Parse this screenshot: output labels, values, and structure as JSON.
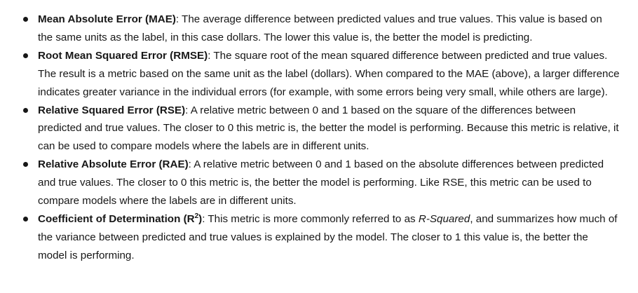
{
  "metrics": [
    {
      "term": "Mean Absolute Error (MAE)",
      "description": ": The average difference between predicted values and true values. This value is based on the same units as the label, in this case dollars. The lower this value is, the better the model is predicting."
    },
    {
      "term": "Root Mean Squared Error (RMSE)",
      "description": ": The square root of the mean squared difference between predicted and true values. The result is a metric based on the same unit as the label (dollars). When compared to the MAE (above), a larger difference indicates greater variance in the individual errors (for example, with some errors being very small, while others are large)."
    },
    {
      "term": "Relative Squared Error (RSE)",
      "description": ": A relative metric between 0 and 1 based on the square of the differences between predicted and true values. The closer to 0 this metric is, the better the model is performing. Because this metric is relative, it can be used to compare models where the labels are in different units."
    },
    {
      "term": "Relative Absolute Error (RAE)",
      "description": ": A relative metric between 0 and 1 based on the absolute differences between predicted and true values. The closer to 0 this metric is, the better the model is performing. Like RSE, this metric can be used to compare models where the labels are in different units."
    },
    {
      "term_prefix": "Coefficient of Determination (R",
      "term_sup": "2",
      "term_suffix": ")",
      "description_before": ": This metric is more commonly referred to as ",
      "description_em": "R-Squared",
      "description_after": ", and summarizes how much of the variance between predicted and true values is explained by the model. The closer to 1 this value is, the better the model is performing."
    }
  ]
}
